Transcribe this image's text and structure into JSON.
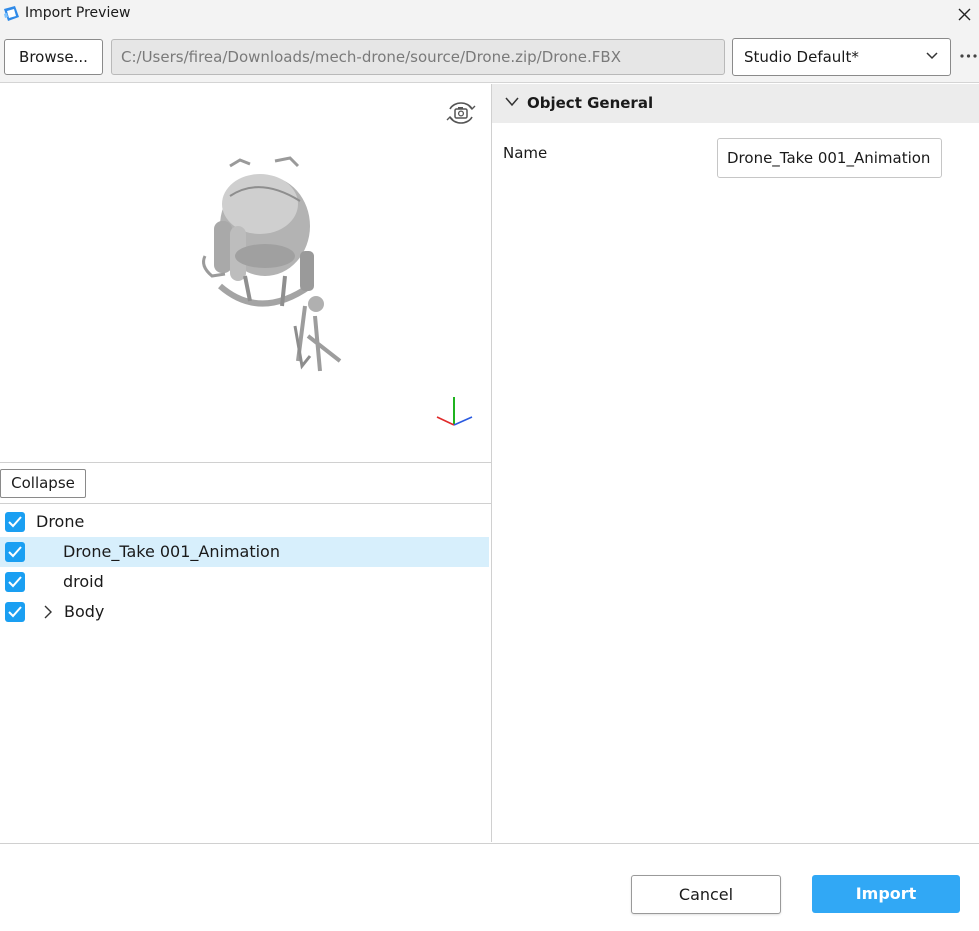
{
  "window": {
    "title": "Import Preview",
    "close_icon": "close-icon",
    "app_icon": "roblox-studio-icon"
  },
  "toolbar": {
    "browse_label": "Browse...",
    "file_path": "C:/Users/firea/Downloads/mech-drone/source/Drone.zip/Drone.FBX",
    "preset_selected": "Studio Default*",
    "more_icon": "more-horizontal-icon"
  },
  "viewport": {
    "camera_icon": "rotate-camera-icon",
    "gizmo_icon": "axis-gizmo-icon"
  },
  "hierarchy": {
    "collapse_label": "Collapse",
    "items": [
      {
        "label": "Drone",
        "checked": true,
        "selected": false,
        "expandable": false
      },
      {
        "label": "Drone_Take 001_Animation",
        "checked": true,
        "selected": true,
        "expandable": false
      },
      {
        "label": "droid",
        "checked": true,
        "selected": false,
        "expandable": false
      },
      {
        "label": "Body",
        "checked": true,
        "selected": false,
        "expandable": true
      }
    ]
  },
  "properties": {
    "section_title": "Object General",
    "fields": [
      {
        "label": "Name",
        "value": "Drone_Take 001_Animation"
      }
    ]
  },
  "footer": {
    "cancel_label": "Cancel",
    "import_label": "Import"
  },
  "colors": {
    "accent": "#31a8f5",
    "checkbox": "#1a9ff2",
    "selected_row": "#d7effc",
    "header_bg": "#ececec"
  }
}
